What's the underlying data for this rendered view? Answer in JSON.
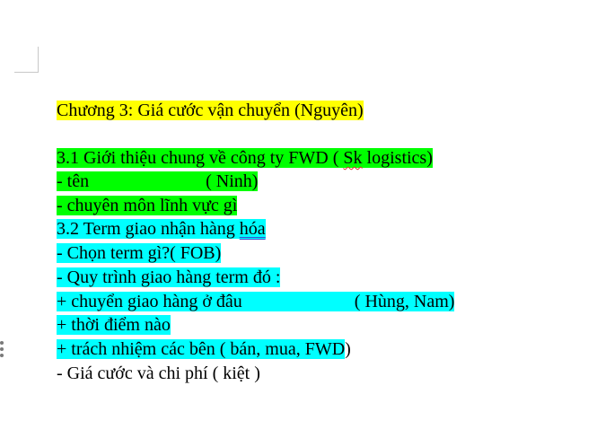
{
  "document": {
    "heading": "Chương 3: Giá cước vận chuyển (Nguyên)",
    "sec31_prefix": "3.1 Giới thiệu chung về công ty FWD ( ",
    "sec31_sk": "Sk",
    "sec31_suffix": " logistics)",
    "ten_label": "- tên",
    "ten_gap": "                          ",
    "ten_owner": "( Ninh)",
    "chuyen_mon": "- chuyên môn lĩnh vực gì",
    "sec32_prefix": "3.2 Term giao nhận hàng ",
    "sec32_hoa": "hóa",
    "chon_term": "- Chọn term gì?( FOB)",
    "quy_trinh": "- Quy trình giao hàng term đó :",
    "chuyen_giao_label": "+ chuyển giao hàng ở đâu",
    "chuyen_giao_gap": "                         ",
    "chuyen_giao_owner": "( Hùng, Nam)",
    "thoi_diem": "+ thời điểm nào",
    "trach_nhiem": "+ trách nhiệm các bên ( bán, mua, FWD",
    "trach_nhiem_end": ")",
    "gia_cuoc": "- Giá cước và chi phí ( kiệt )"
  },
  "colors": {
    "yellow_highlight": "#ffff00",
    "green_highlight": "#00ff00",
    "cyan_highlight": "#00ffff"
  }
}
